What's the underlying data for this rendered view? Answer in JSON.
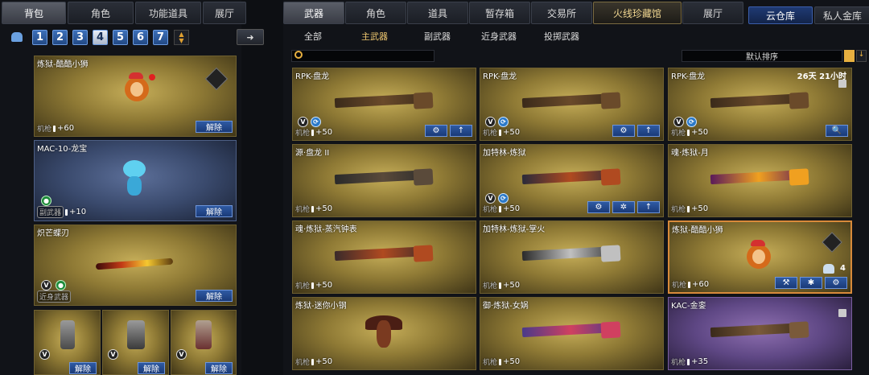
{
  "left_tabs": [
    "背包",
    "角色",
    "功能道具",
    "展厅"
  ],
  "pages": [
    "1",
    "2",
    "3",
    "4",
    "5",
    "6",
    "7"
  ],
  "active_page": "4",
  "right_tabs": [
    "武器",
    "角色",
    "道具",
    "暂存箱",
    "交易所",
    "火线珍藏馆",
    "展厅"
  ],
  "storage_tabs": [
    "云仓库",
    "私人金库"
  ],
  "sub_tabs": [
    "全部",
    "主武器",
    "副武器",
    "近身武器",
    "投掷武器"
  ],
  "sort_label": "默认排序",
  "left_items": [
    {
      "name": "炼狱-酷酷小狮",
      "category": "机枪",
      "count": "+60",
      "action": "解除"
    },
    {
      "name": "MAC-10-龙宝",
      "category": "副武器",
      "count": "+10",
      "action": "解除"
    },
    {
      "name": "炽芒蝶刃",
      "category": "近身武器",
      "count": "",
      "action": "解除"
    }
  ],
  "grenades": [
    {
      "action": "解除"
    },
    {
      "action": "解除"
    },
    {
      "action": "解除"
    }
  ],
  "grid": [
    {
      "name": "RPK-盘龙",
      "category": "机枪",
      "count": "+50",
      "timer": ""
    },
    {
      "name": "RPK-盘龙",
      "category": "机枪",
      "count": "+50",
      "timer": ""
    },
    {
      "name": "RPK-盘龙",
      "category": "机枪",
      "count": "+50",
      "timer": "26天 21小时"
    },
    {
      "name": "源·盘龙 II",
      "category": "机枪",
      "count": "+50",
      "timer": ""
    },
    {
      "name": "加特林-炼狱",
      "category": "机枪",
      "count": "+50",
      "timer": ""
    },
    {
      "name": "魂·炼狱-月",
      "category": "机枪",
      "count": "+50",
      "timer": ""
    },
    {
      "name": "魂·炼狱-蒸汽钟表",
      "category": "机枪",
      "count": "+50",
      "timer": ""
    },
    {
      "name": "加特林-炼狱-掌火",
      "category": "机枪",
      "count": "+50",
      "timer": ""
    },
    {
      "name": "炼狱-酷酷小狮",
      "category": "机枪",
      "count": "+60",
      "timer": "",
      "stack": "4"
    },
    {
      "name": "炼狱-迷你小钢",
      "category": "机枪",
      "count": "+50",
      "timer": ""
    },
    {
      "name": "御·炼狱-女娲",
      "category": "机枪",
      "count": "+50",
      "timer": ""
    },
    {
      "name": "KAC-金銮",
      "category": "机枪",
      "count": "+35",
      "timer": ""
    }
  ]
}
